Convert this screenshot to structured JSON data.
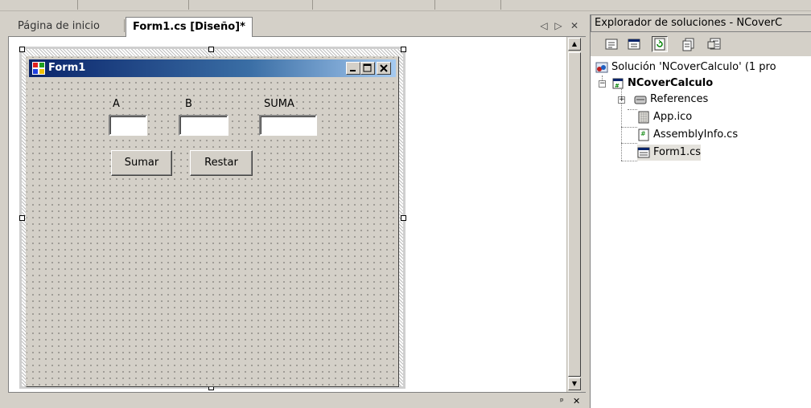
{
  "document_tabs": {
    "inactive_tab": "Página de inicio",
    "active_tab": "Form1.cs [Diseño]*",
    "nav_left": "◁",
    "nav_right": "▷",
    "close": "✕"
  },
  "form": {
    "title": "Form1",
    "label_a": "A",
    "label_b": "B",
    "label_suma": "SUMA",
    "button_sumar": "Sumar",
    "button_restar": "Restar"
  },
  "solution_explorer": {
    "title": "Explorador de soluciones - NCoverC",
    "tree": {
      "solution": "Solución 'NCoverCalculo' (1 pro",
      "project": "NCoverCalculo",
      "references": "References",
      "app_ico": "App.ico",
      "assembly_info": "AssemblyInfo.cs",
      "form1": "Form1.cs"
    }
  },
  "bottom_bar": {
    "pin": "ᵖ",
    "close": "✕"
  },
  "colors": {
    "titlebar_start": "#0a246a",
    "titlebar_end": "#a6caf0",
    "chrome": "#d4d0c8"
  }
}
